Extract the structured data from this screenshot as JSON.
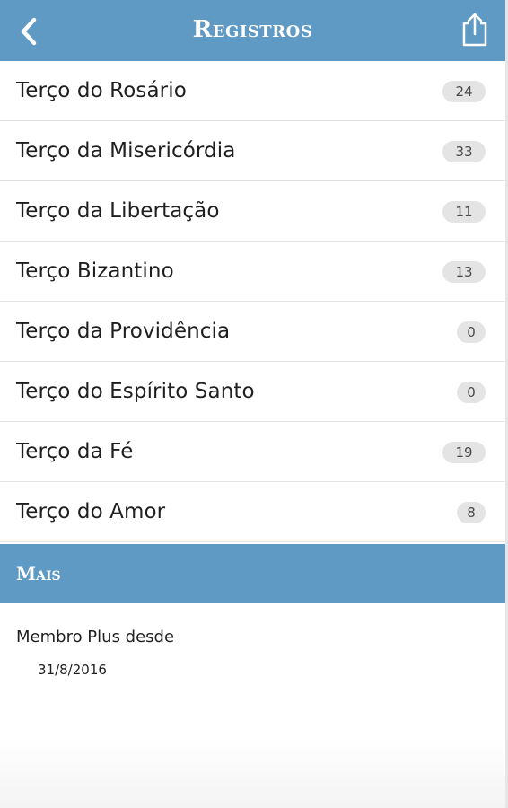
{
  "header": {
    "title": "Registros",
    "back_icon": "chevron-left-icon",
    "share_icon": "share-icon",
    "bg_color": "#5f9ac4"
  },
  "list": {
    "items": [
      {
        "label": "Terço do Rosário",
        "count": "24"
      },
      {
        "label": "Terço da Misericórdia",
        "count": "33"
      },
      {
        "label": "Terço da Libertação",
        "count": "11"
      },
      {
        "label": "Terço Bizantino",
        "count": "13"
      },
      {
        "label": "Terço da Providência",
        "count": "0"
      },
      {
        "label": "Terço do Espírito Santo",
        "count": "0"
      },
      {
        "label": "Terço da Fé",
        "count": "19"
      },
      {
        "label": "Terço do Amor",
        "count": "8"
      }
    ]
  },
  "section": {
    "title": "Mais"
  },
  "membership": {
    "label": "Membro Plus desde",
    "date": "31/8/2016"
  }
}
